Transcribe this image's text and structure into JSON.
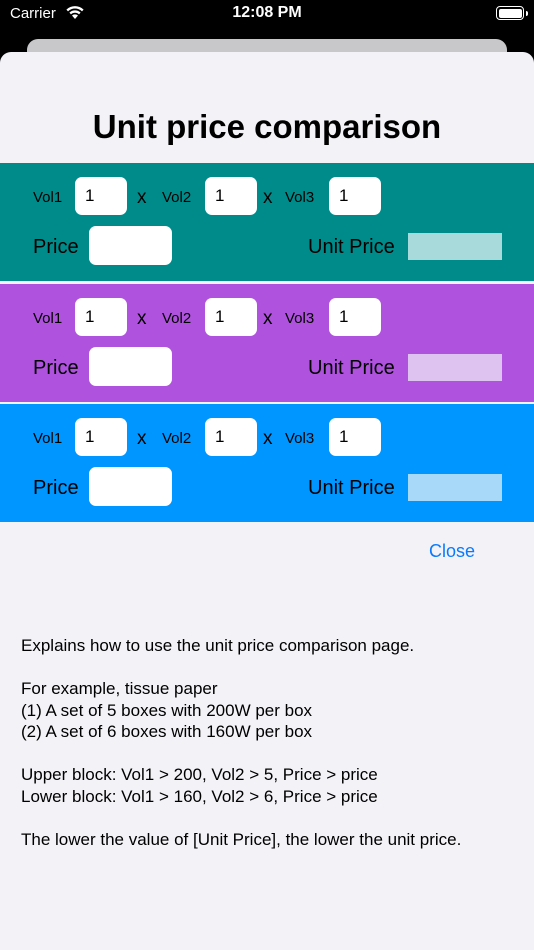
{
  "status_bar": {
    "carrier": "Carrier",
    "time": "12:08 PM",
    "wifi_icon": "wifi-icon",
    "battery_icon": "battery-icon"
  },
  "title": "Unit price comparison",
  "colors": {
    "block1": "#008b8b",
    "block2": "#af52de",
    "block3": "#0096ff",
    "close": "#0a7aff",
    "background": "#f2f2f7"
  },
  "blocks": [
    {
      "vol1_label": "Vol1",
      "vol1": "1",
      "times1": "x",
      "vol2_label": "Vol2",
      "vol2": "1",
      "times2": "x",
      "vol3_label": "Vol3",
      "vol3": "1",
      "price_label": "Price",
      "price": "",
      "unit_price_label": "Unit Price",
      "unit_price": ""
    },
    {
      "vol1_label": "Vol1",
      "vol1": "1",
      "times1": "x",
      "vol2_label": "Vol2",
      "vol2": "1",
      "times2": "x",
      "vol3_label": "Vol3",
      "vol3": "1",
      "price_label": "Price",
      "price": "",
      "unit_price_label": "Unit Price",
      "unit_price": ""
    },
    {
      "vol1_label": "Vol1",
      "vol1": "1",
      "times1": "x",
      "vol2_label": "Vol2",
      "vol2": "1",
      "times2": "x",
      "vol3_label": "Vol3",
      "vol3": "1",
      "price_label": "Price",
      "price": "",
      "unit_price_label": "Unit Price",
      "unit_price": ""
    }
  ],
  "close_label": "Close",
  "help": {
    "intro": "Explains how to use the unit price comparison page.",
    "example_heading": "For example, tissue paper",
    "example_1": "(1) A set of 5 boxes with 200W per box",
    "example_2": "(2) A set of 6 boxes with 160W per box",
    "upper_block": "Upper block: Vol1 > 200, Vol2 > 5, Price > price",
    "lower_block": "Lower block: Vol1 > 160, Vol2 > 6, Price > price",
    "conclusion": "The lower the value of [Unit Price], the lower the unit price."
  }
}
